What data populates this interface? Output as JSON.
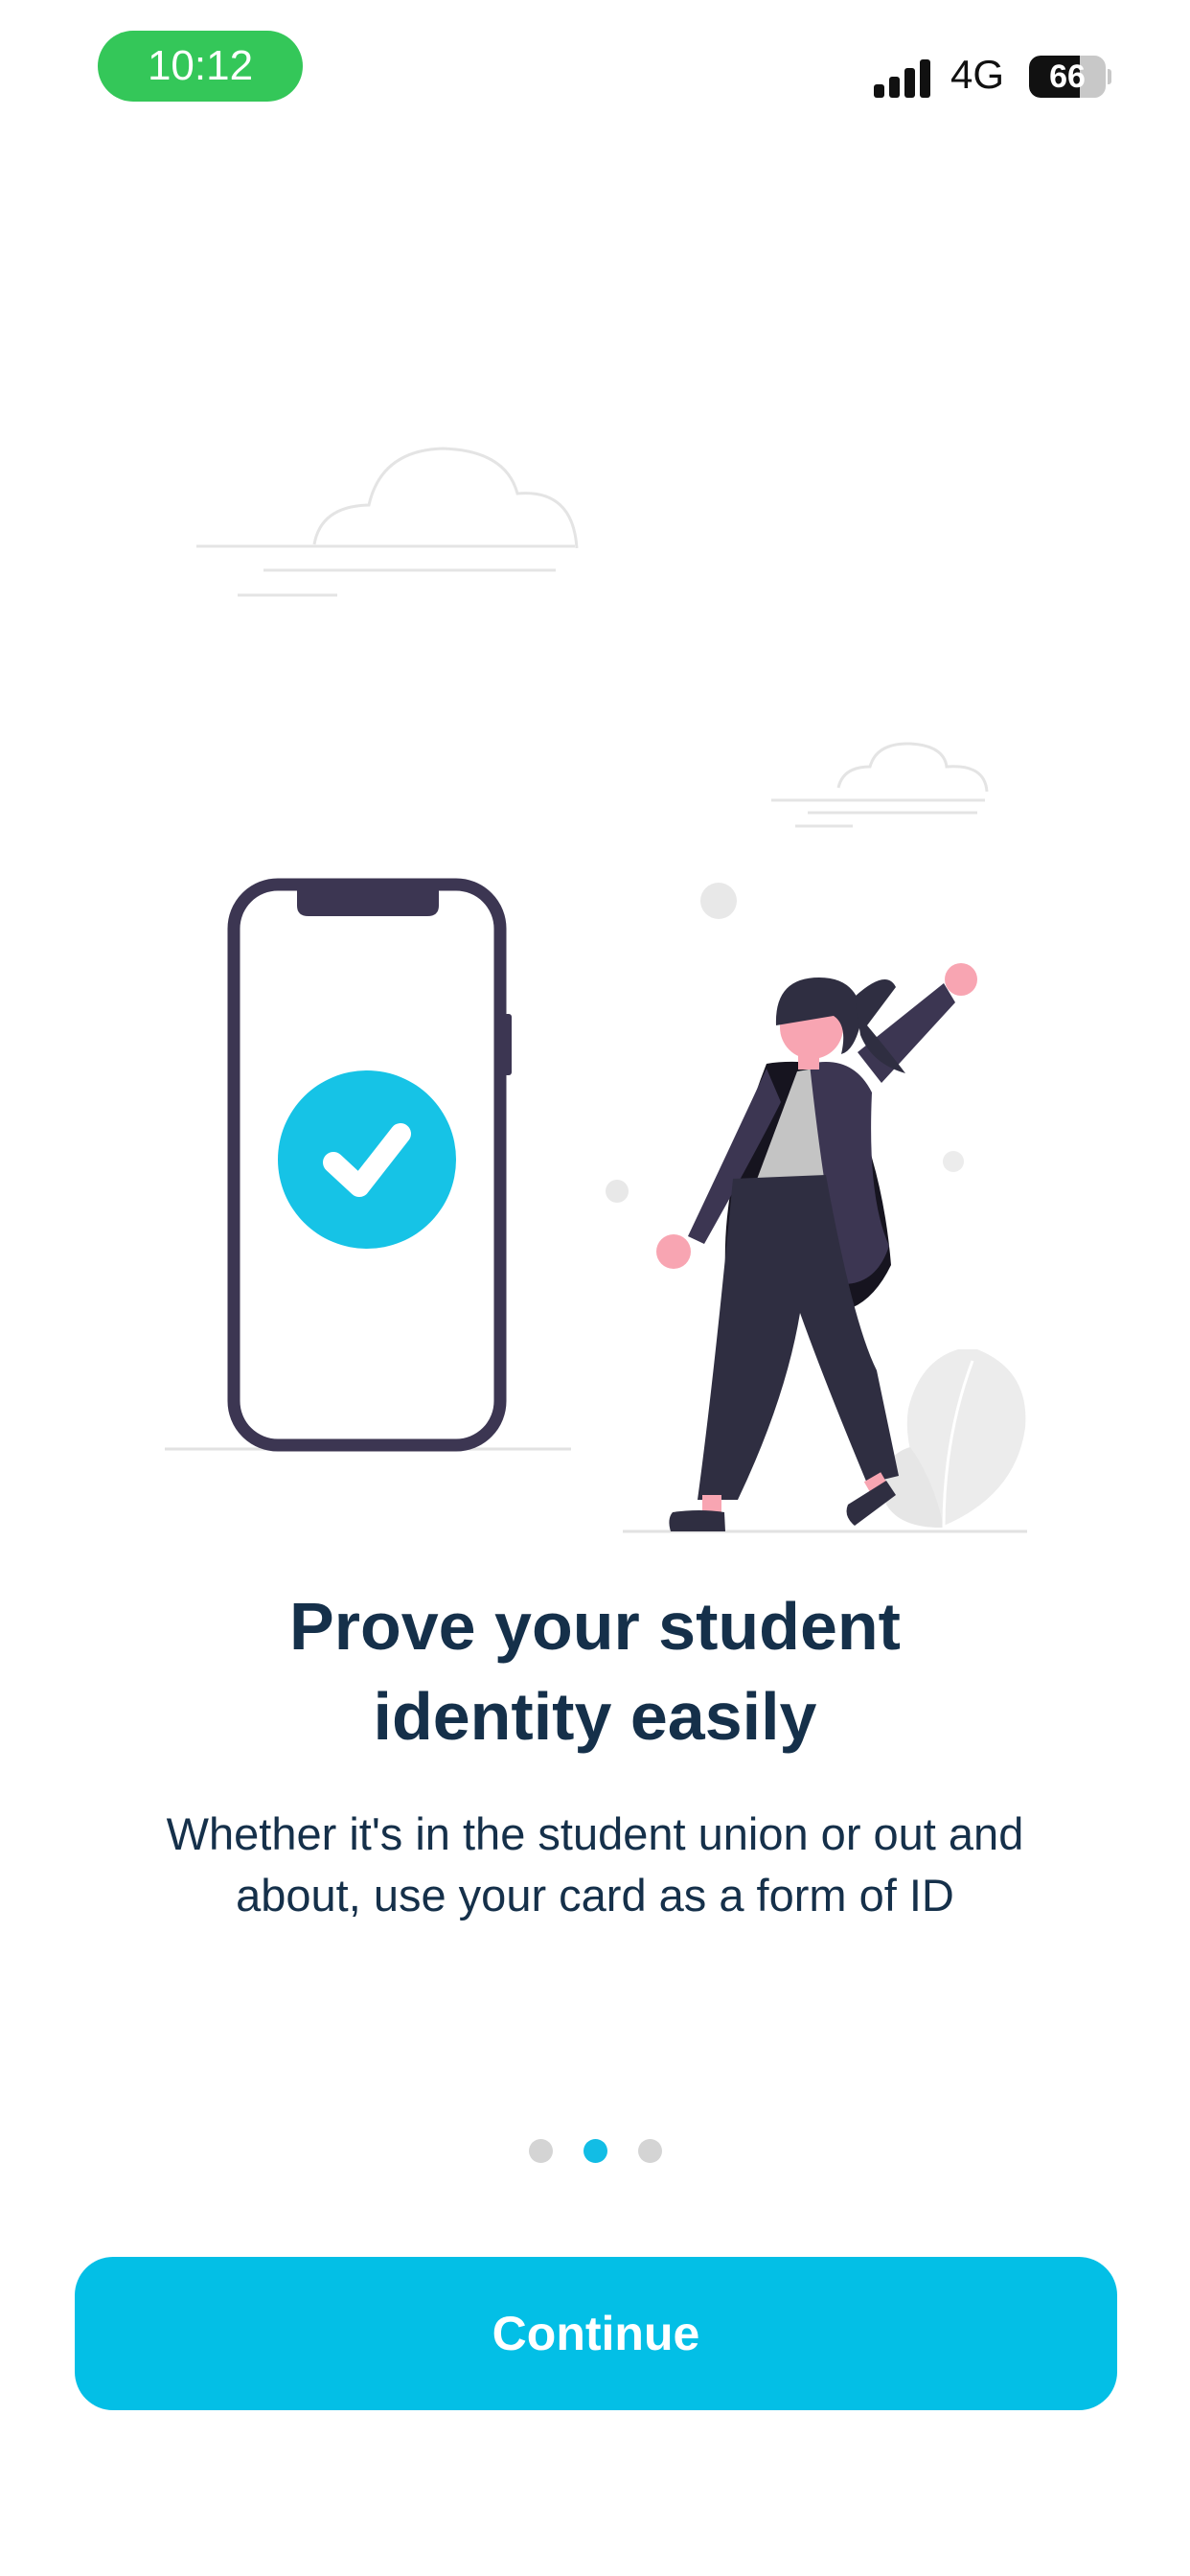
{
  "status_bar": {
    "time": "10:12",
    "network": "4G",
    "battery_level": "66",
    "battery_fraction": 0.66,
    "signal_bars": 4
  },
  "illustration": {
    "accent_color": "#16c3e6",
    "phone_frame_color": "#3c3652",
    "icon": "check-icon"
  },
  "onboarding": {
    "headline_line1": "Prove your student",
    "headline_line2": "identity easily",
    "description_line1": "Whether it's in the student union or out and",
    "description_line2": "about, use your card as a form of ID"
  },
  "pagination": {
    "total_pages": 3,
    "current_page": 2
  },
  "buttons": {
    "continue_label": "Continue"
  },
  "colors": {
    "primary": "#03bfe6",
    "text": "#15304a",
    "dot_inactive": "#d4d4d4",
    "status_time_bg": "#34c759"
  }
}
